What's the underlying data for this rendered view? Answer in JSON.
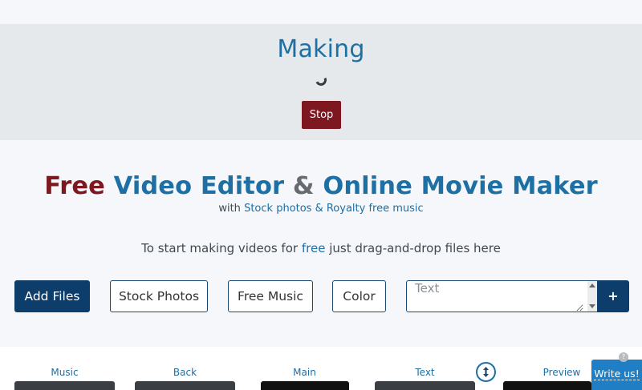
{
  "status": {
    "title": "Making",
    "stop_label": "Stop"
  },
  "headline": {
    "free": "Free",
    "part1": "Video Editor",
    "amp": "&",
    "part2": "Online Movie Maker"
  },
  "subline": {
    "with": "with",
    "link": "Stock photos & Royalty free music"
  },
  "instruction": {
    "before": "To start making videos for",
    "free": "free",
    "after": "just drag-and-drop files here"
  },
  "toolbar": {
    "add_files": "Add Files",
    "stock_photos": "Stock Photos",
    "free_music": "Free Music",
    "color": "Color",
    "text_placeholder": "Text",
    "plus": "+"
  },
  "timeline": {
    "tracks": [
      "Music",
      "Back",
      "Main",
      "Text",
      "Preview"
    ]
  },
  "feedback": {
    "write_us": "Write us!",
    "help_badge": "?"
  },
  "colors": {
    "accent_blue": "#1e6fa3",
    "dark_navy": "#0d3d6b",
    "stop_red": "#7e1820",
    "feedback_blue": "#1f7ec4"
  },
  "icons": [
    "loading-spinner-icon",
    "swap-vertical-icon",
    "scroll-up-arrow-icon",
    "scroll-down-arrow-icon"
  ]
}
